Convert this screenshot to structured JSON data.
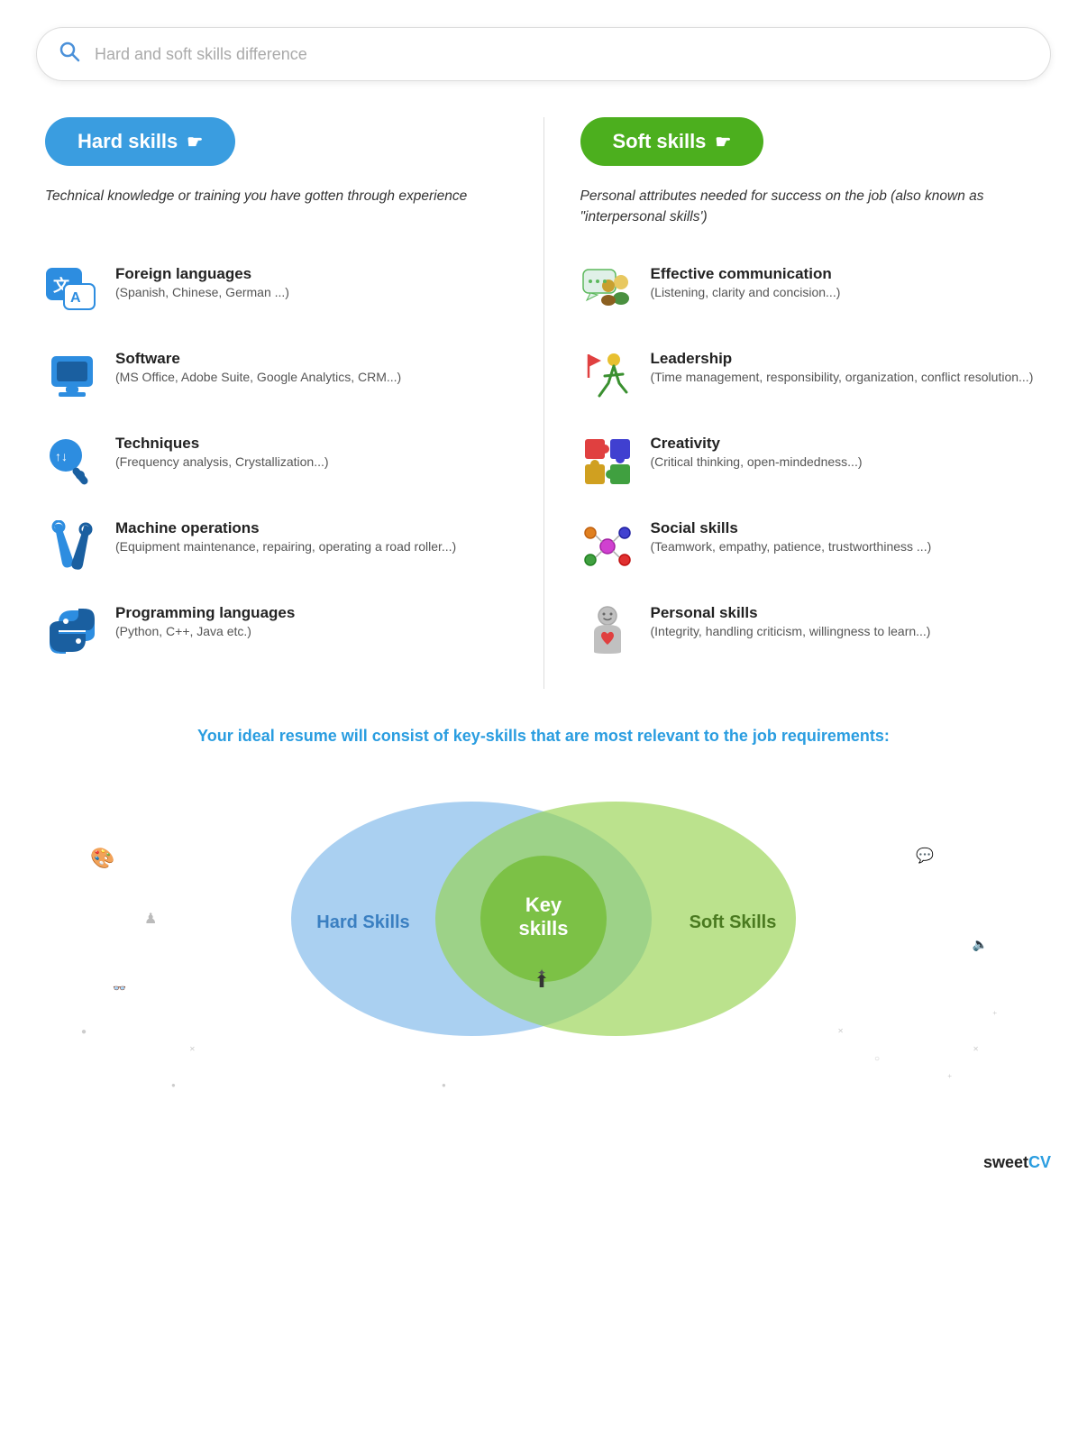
{
  "search": {
    "placeholder": "Hard and soft skills difference"
  },
  "hard_skills": {
    "badge_label": "Hard skills",
    "description": "Technical knowledge or training you have gotten through experience",
    "items": [
      {
        "title": "Foreign languages",
        "subtitle": "(Spanish, Chinese, German ...)",
        "icon": "foreign-lang"
      },
      {
        "title": "Software",
        "subtitle": "(MS Office, Adobe Suite, Google Analytics, CRM...)",
        "icon": "software"
      },
      {
        "title": "Techniques",
        "subtitle": "(Frequency analysis, Crystallization...)",
        "icon": "techniques"
      },
      {
        "title": "Machine operations",
        "subtitle": "(Equipment maintenance, repairing, operating a road roller...)",
        "icon": "machine"
      },
      {
        "title": "Programming languages",
        "subtitle": "(Python, C++, Java etc.)",
        "icon": "programming"
      }
    ]
  },
  "soft_skills": {
    "badge_label": "Soft skills",
    "description": "Personal attributes needed for success on the job (also known as \"interpersonal skills')",
    "items": [
      {
        "title": "Effective communication",
        "subtitle": "(Listening, clarity and concision...)",
        "icon": "communication"
      },
      {
        "title": "Leadership",
        "subtitle": "(Time management, responsibility, organization, conflict resolution...)",
        "icon": "leadership"
      },
      {
        "title": "Creativity",
        "subtitle": "(Critical thinking, open-mindedness...)",
        "icon": "creativity"
      },
      {
        "title": "Social skills",
        "subtitle": "(Teamwork, empathy, patience, trustworthiness ...)",
        "icon": "social"
      },
      {
        "title": "Personal skills",
        "subtitle": "(Integrity, handling criticism, willingness to learn...)",
        "icon": "personal"
      }
    ]
  },
  "venn": {
    "title": "Your ideal resume will consist of key-skills that are most relevant to the job requirements:",
    "hard_label": "Hard Skills",
    "soft_label": "Soft Skills",
    "center_label": "Key\nskills"
  },
  "branding": {
    "sweet": "sweet",
    "cv": "CV"
  }
}
